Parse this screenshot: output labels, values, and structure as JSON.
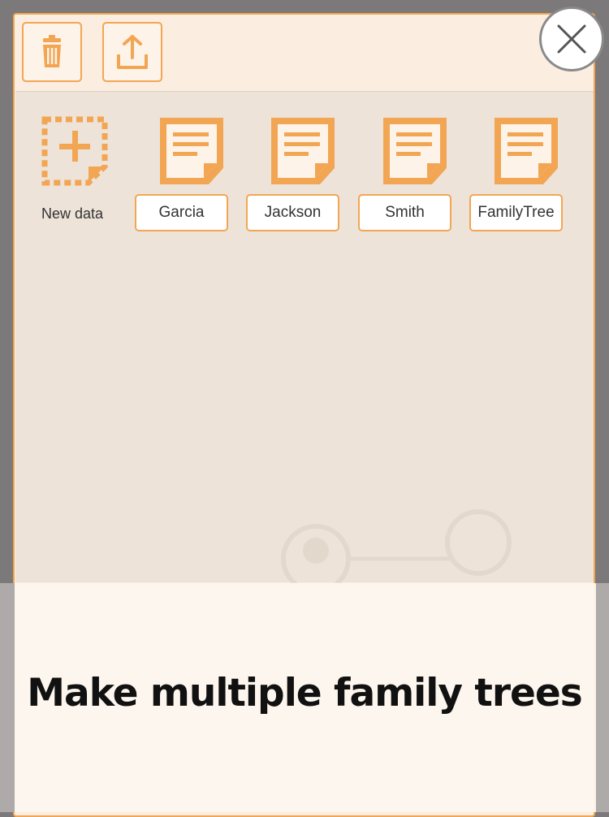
{
  "toolbar": {
    "delete_icon": "trash-icon",
    "export_icon": "share-export-icon"
  },
  "close_icon": "close-x-icon",
  "new_data": {
    "label": "New data",
    "icon": "dashed-plus-document-icon"
  },
  "files": [
    {
      "label": "Garcia"
    },
    {
      "label": "Jackson"
    },
    {
      "label": "Smith"
    },
    {
      "label": "FamilyTree"
    }
  ],
  "caption": "Make multiple family trees",
  "colors": {
    "accent": "#f2a654",
    "panel_bg": "#fbeee0",
    "list_bg": "#ede3d8",
    "backdrop": "#7b7979"
  }
}
